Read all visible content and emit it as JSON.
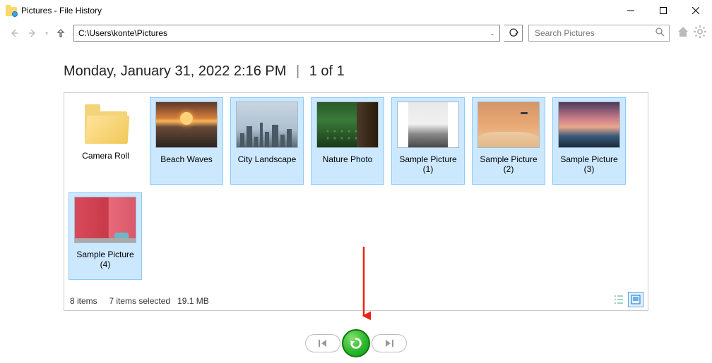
{
  "window": {
    "title": "Pictures - File History"
  },
  "nav": {
    "path": "C:\\Users\\konte\\Pictures"
  },
  "search": {
    "placeholder": "Search Pictures"
  },
  "header": {
    "timestamp": "Monday, January 31, 2022 2:16 PM",
    "pager": "1 of 1"
  },
  "items": [
    {
      "label": "Camera Roll",
      "type": "folder",
      "selected": false
    },
    {
      "label": "Beach Waves",
      "type": "image",
      "thumb": "beach",
      "selected": true
    },
    {
      "label": "City Landscape",
      "type": "image",
      "thumb": "city",
      "selected": true
    },
    {
      "label": "Nature Photo",
      "type": "image",
      "thumb": "nature",
      "selected": true
    },
    {
      "label": "Sample Picture (1)",
      "type": "image",
      "thumb": "mono",
      "selected": true,
      "tall": true
    },
    {
      "label": "Sample Picture (2)",
      "type": "image",
      "thumb": "sun",
      "selected": true
    },
    {
      "label": "Sample Picture (3)",
      "type": "image",
      "thumb": "pink",
      "selected": true
    },
    {
      "label": "Sample Picture (4)",
      "type": "image",
      "thumb": "wall",
      "selected": true
    }
  ],
  "status": {
    "count": "8 items",
    "selection": "7 items selected",
    "size": "19.1 MB"
  }
}
